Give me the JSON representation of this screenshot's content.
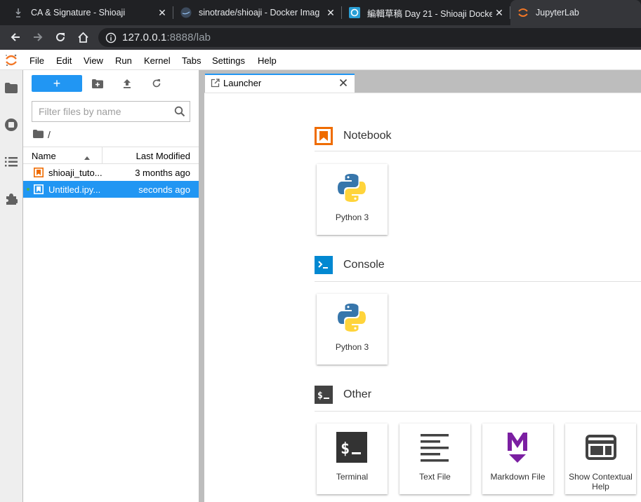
{
  "browser": {
    "tabs": [
      {
        "title": "CA & Signature - Shioaji"
      },
      {
        "title": "sinotrade/shioaji - Docker Imag"
      },
      {
        "title": "編輯草稿 Day 21 - Shioaji Docke"
      },
      {
        "title": "JupyterLab"
      }
    ],
    "url_host": "127.0.0.1",
    "url_rest": ":8888/lab"
  },
  "menubar": {
    "items": [
      "File",
      "Edit",
      "View",
      "Run",
      "Kernel",
      "Tabs",
      "Settings",
      "Help"
    ]
  },
  "filebrowser": {
    "new_label": "+",
    "filter_placeholder": "Filter files by name",
    "breadcrumb": "/",
    "columns": {
      "name": "Name",
      "modified": "Last Modified"
    },
    "files": [
      {
        "name": "shioaji_tuto...",
        "modified": "3 months ago",
        "selected": false
      },
      {
        "name": "Untitled.ipy...",
        "modified": "seconds ago",
        "selected": true
      }
    ]
  },
  "main": {
    "tab_title": "Launcher"
  },
  "launcher": {
    "sections": [
      {
        "title": "Notebook",
        "icon": "notebook-icon",
        "color": "#ef6c00",
        "cards": [
          {
            "label": "Python 3",
            "icon": "python-icon"
          }
        ]
      },
      {
        "title": "Console",
        "icon": "console-icon",
        "color": "#0288d1",
        "cards": [
          {
            "label": "Python 3",
            "icon": "python-icon"
          }
        ]
      },
      {
        "title": "Other",
        "icon": "other-icon",
        "color": "#424242",
        "cards": [
          {
            "label": "Terminal",
            "icon": "terminal-icon"
          },
          {
            "label": "Text File",
            "icon": "text-file-icon"
          },
          {
            "label": "Markdown File",
            "icon": "markdown-icon"
          },
          {
            "label": "Show Contextual Help",
            "icon": "contextual-help-icon"
          }
        ]
      }
    ]
  },
  "colors": {
    "accent": "#2196f3",
    "notebook": "#ef6c00",
    "console": "#0288d1",
    "markdown": "#7b1fa2",
    "jupyter_orange": "#f37726"
  }
}
